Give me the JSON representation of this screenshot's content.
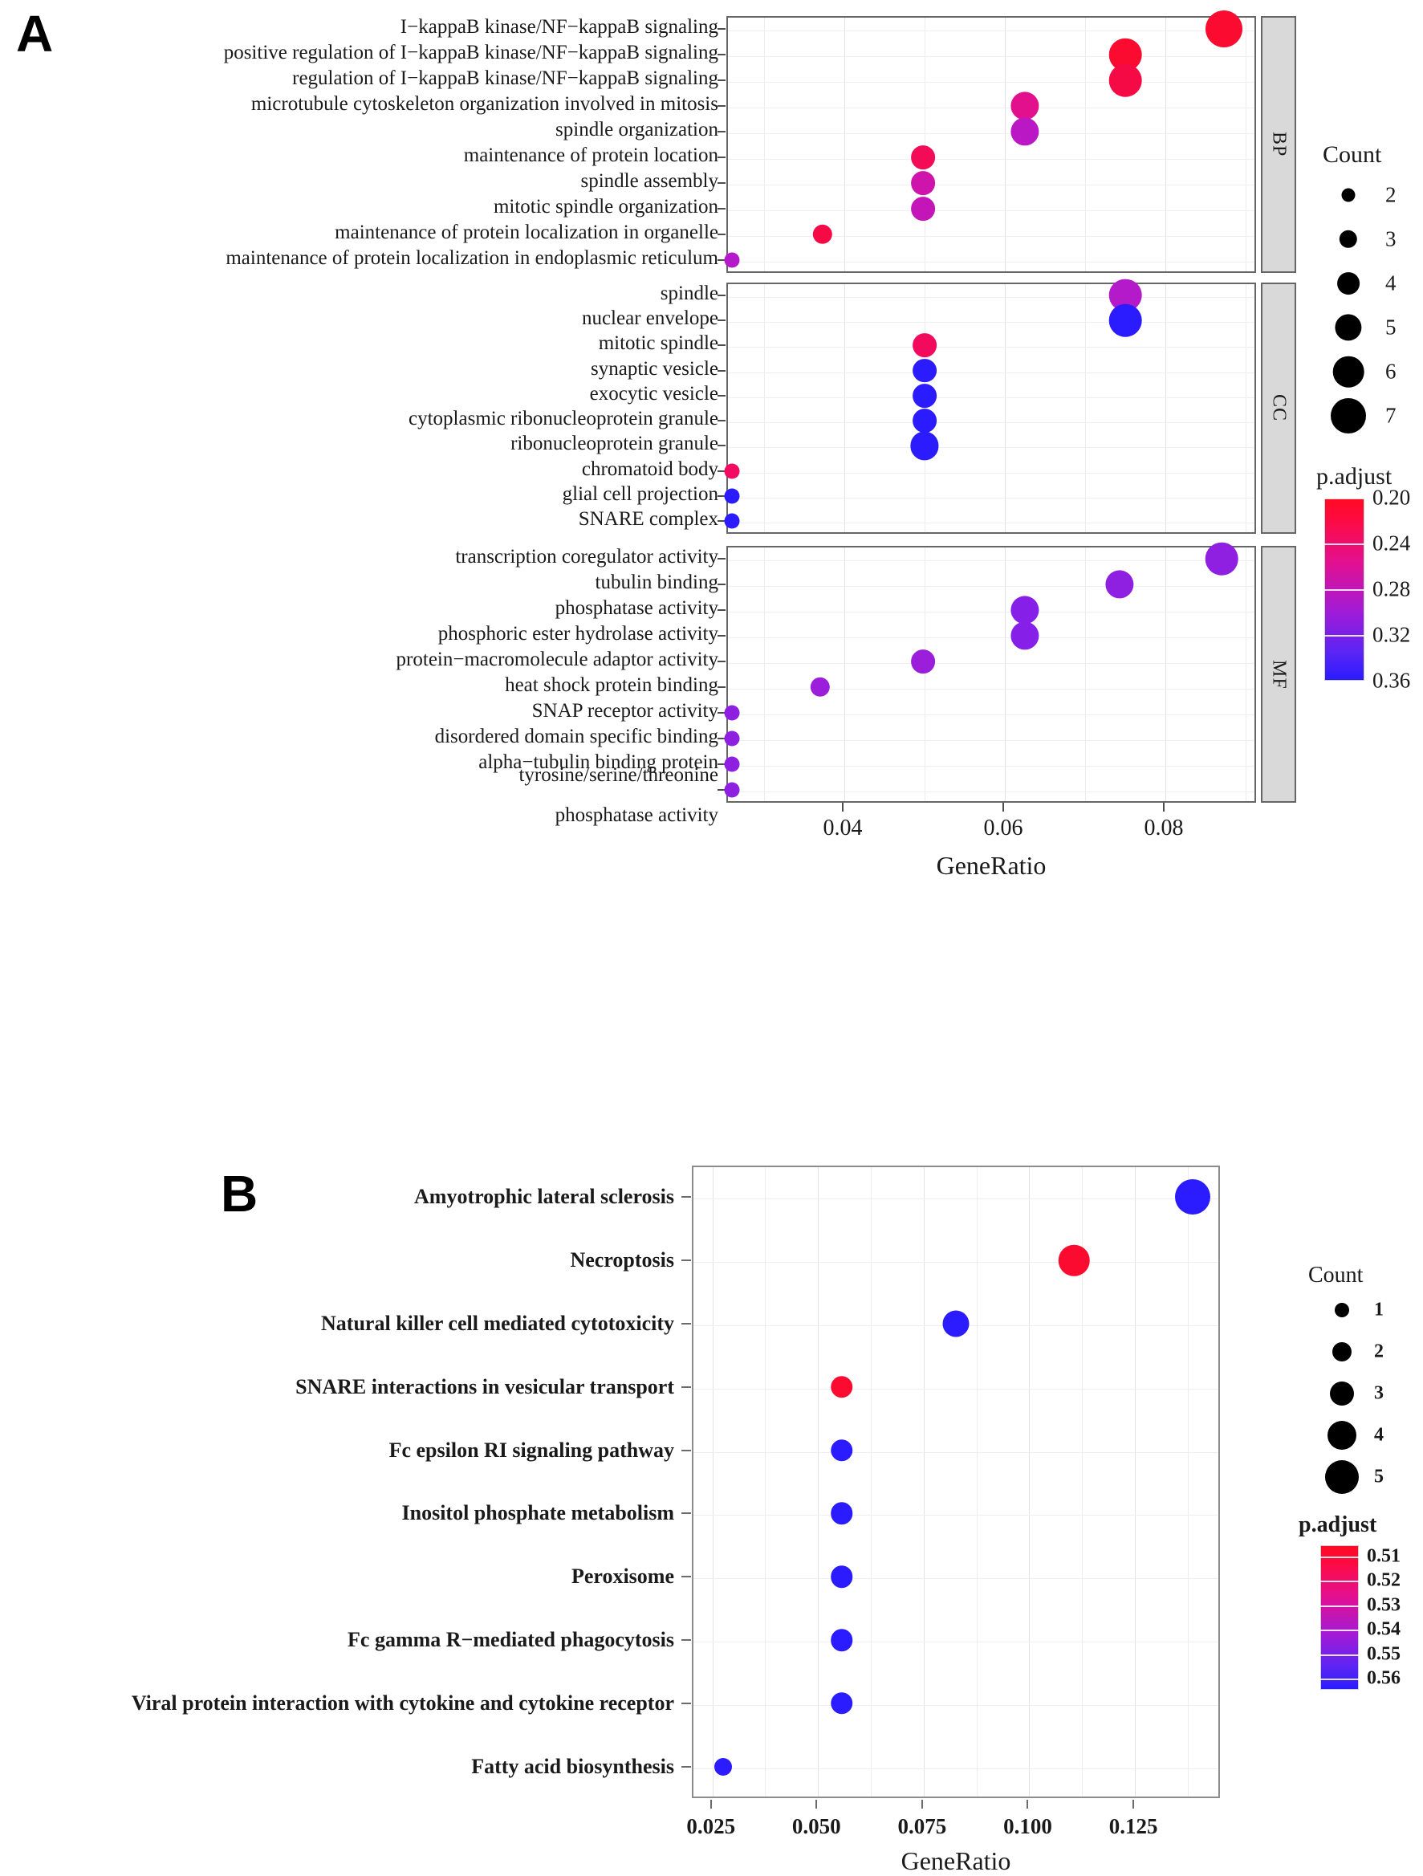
{
  "panels": {
    "a": {
      "letter": "A"
    },
    "b": {
      "letter": "B"
    }
  },
  "chart_data": [
    {
      "panel": "A",
      "type": "scatter",
      "title": "",
      "xlabel": "GeneRatio",
      "ylabel": "",
      "xlim": [
        0.0255,
        0.0915
      ],
      "xticks": [
        0.04,
        0.06,
        0.08
      ],
      "xticklabels": [
        "0.04",
        "0.06",
        "0.08"
      ],
      "grid": true,
      "facets": [
        {
          "name": "BP",
          "strip_label": "BP",
          "points": [
            {
              "term": "I−kappaB kinase/NF−kappaB signaling",
              "gene_ratio": 0.0875,
              "count": 7,
              "p_adjust": 0.205,
              "color": "#fb0b2f"
            },
            {
              "term": "positive regulation of I−kappaB kinase/NF−kappaB signaling",
              "gene_ratio": 0.0752,
              "count": 6,
              "p_adjust": 0.205,
              "color": "#fb0b2f"
            },
            {
              "term": "regulation of I−kappaB kinase/NF−kappaB signaling",
              "gene_ratio": 0.0752,
              "count": 6,
              "p_adjust": 0.215,
              "color": "#f50a45"
            },
            {
              "term": "microtubule cytoskeleton organization involved in mitosis",
              "gene_ratio": 0.0627,
              "count": 5,
              "p_adjust": 0.255,
              "color": "#e2108c"
            },
            {
              "term": "spindle organization",
              "gene_ratio": 0.0627,
              "count": 5,
              "p_adjust": 0.295,
              "color": "#b918c4"
            },
            {
              "term": "maintenance of protein location",
              "gene_ratio": 0.05,
              "count": 4,
              "p_adjust": 0.225,
              "color": "#f30b57"
            },
            {
              "term": "spindle assembly",
              "gene_ratio": 0.05,
              "count": 4,
              "p_adjust": 0.275,
              "color": "#cf14ac"
            },
            {
              "term": "mitotic spindle organization",
              "gene_ratio": 0.05,
              "count": 4,
              "p_adjust": 0.285,
              "color": "#c416b8"
            },
            {
              "term": "maintenance of protein localization in organelle",
              "gene_ratio": 0.0375,
              "count": 3,
              "p_adjust": 0.215,
              "color": "#f60a45"
            },
            {
              "term": "maintenance of protein localization in endoplasmic reticulum",
              "gene_ratio": 0.0262,
              "count": 2,
              "p_adjust": 0.3,
              "color": "#b41ac9"
            }
          ]
        },
        {
          "name": "CC",
          "strip_label": "CC",
          "points": [
            {
              "term": "spindle",
              "gene_ratio": 0.0752,
              "count": 6,
              "p_adjust": 0.3,
              "color": "#b41ac9"
            },
            {
              "term": "nuclear envelope",
              "gene_ratio": 0.0752,
              "count": 6,
              "p_adjust": 0.36,
              "color": "#2a1cff"
            },
            {
              "term": "mitotic spindle",
              "gene_ratio": 0.0502,
              "count": 4,
              "p_adjust": 0.23,
              "color": "#f20b5c"
            },
            {
              "term": "synaptic vesicle",
              "gene_ratio": 0.0502,
              "count": 4,
              "p_adjust": 0.36,
              "color": "#2a1cff"
            },
            {
              "term": "exocytic vesicle",
              "gene_ratio": 0.0502,
              "count": 4,
              "p_adjust": 0.36,
              "color": "#2a1cff"
            },
            {
              "term": "cytoplasmic ribonucleoprotein granule",
              "gene_ratio": 0.0502,
              "count": 4,
              "p_adjust": 0.36,
              "color": "#2a1cff"
            },
            {
              "term": "ribonucleoprotein granule",
              "gene_ratio": 0.0502,
              "count": 5,
              "p_adjust": 0.36,
              "color": "#2a1cff"
            },
            {
              "term": "chromatoid body",
              "gene_ratio": 0.0262,
              "count": 2,
              "p_adjust": 0.235,
              "color": "#f20b63"
            },
            {
              "term": "glial cell projection",
              "gene_ratio": 0.0262,
              "count": 2,
              "p_adjust": 0.36,
              "color": "#2a1cff"
            },
            {
              "term": "SNARE complex",
              "gene_ratio": 0.0262,
              "count": 2,
              "p_adjust": 0.36,
              "color": "#2a1cff"
            }
          ]
        },
        {
          "name": "MF",
          "strip_label": "MF",
          "points": [
            {
              "term": "transcription coregulator activity",
              "gene_ratio": 0.0872,
              "count": 6,
              "p_adjust": 0.315,
              "color": "#8f20e2"
            },
            {
              "term": "tubulin binding",
              "gene_ratio": 0.0745,
              "count": 5,
              "p_adjust": 0.315,
              "color": "#8f20e2"
            },
            {
              "term": "phosphatase activity",
              "gene_ratio": 0.0627,
              "count": 5,
              "p_adjust": 0.32,
              "color": "#8620e8"
            },
            {
              "term": "phosphoric ester hydrolase activity",
              "gene_ratio": 0.0627,
              "count": 5,
              "p_adjust": 0.32,
              "color": "#8620e8"
            },
            {
              "term": "protein−macromolecule adaptor activity",
              "gene_ratio": 0.05,
              "count": 4,
              "p_adjust": 0.31,
              "color": "#9a1eda"
            },
            {
              "term": "heat shock protein binding",
              "gene_ratio": 0.0372,
              "count": 3,
              "p_adjust": 0.31,
              "color": "#9a1eda"
            },
            {
              "term": "SNAP receptor activity",
              "gene_ratio": 0.0262,
              "count": 2,
              "p_adjust": 0.315,
              "color": "#8f20e2"
            },
            {
              "term": "disordered domain specific binding",
              "gene_ratio": 0.0262,
              "count": 2,
              "p_adjust": 0.315,
              "color": "#8f20e2"
            },
            {
              "term": "alpha−tubulin binding protein",
              "gene_ratio": 0.0262,
              "count": 2,
              "p_adjust": 0.315,
              "color": "#8f20e2"
            },
            {
              "term": "tyrosine/serine/threonine phosphatase activity",
              "gene_ratio": 0.0262,
              "count": 2,
              "p_adjust": 0.315,
              "color": "#8f20e2"
            }
          ]
        }
      ],
      "size_legend": {
        "title": "Count",
        "values": [
          "2",
          "3",
          "4",
          "5",
          "6",
          "7"
        ]
      },
      "color_legend": {
        "title": "p.adjust",
        "values": [
          "0.20",
          "0.24",
          "0.28",
          "0.32",
          "0.36"
        ],
        "high_color": "#ff0a23",
        "low_color": "#2a1cff"
      }
    },
    {
      "panel": "B",
      "type": "scatter",
      "title": "",
      "xlabel": "GeneRatio",
      "ylabel": "",
      "xlim": [
        0.0205,
        0.1455
      ],
      "xticks": [
        0.025,
        0.05,
        0.075,
        0.1,
        0.125
      ],
      "xticklabels": [
        "0.025",
        "0.050",
        "0.075",
        "0.100",
        "0.125"
      ],
      "grid": true,
      "points": [
        {
          "term": "Amyotrophic lateral sclerosis",
          "gene_ratio": 0.139,
          "count": 5,
          "p_adjust": 0.56,
          "color": "#2a1cff"
        },
        {
          "term": "Necroptosis",
          "gene_ratio": 0.111,
          "count": 4,
          "p_adjust": 0.51,
          "color": "#fb0b2f"
        },
        {
          "term": "Natural killer cell mediated cytotoxicity",
          "gene_ratio": 0.083,
          "count": 3,
          "p_adjust": 0.56,
          "color": "#2a1cff"
        },
        {
          "term": "SNARE interactions in vesicular transport",
          "gene_ratio": 0.056,
          "count": 2,
          "p_adjust": 0.51,
          "color": "#fb0b2f"
        },
        {
          "term": "Fc epsilon RI signaling pathway",
          "gene_ratio": 0.056,
          "count": 2,
          "p_adjust": 0.56,
          "color": "#2a1cff"
        },
        {
          "term": "Inositol phosphate metabolism",
          "gene_ratio": 0.056,
          "count": 2,
          "p_adjust": 0.56,
          "color": "#2a1cff"
        },
        {
          "term": "Peroxisome",
          "gene_ratio": 0.056,
          "count": 2,
          "p_adjust": 0.56,
          "color": "#2a1cff"
        },
        {
          "term": "Fc gamma R−mediated phagocytosis",
          "gene_ratio": 0.056,
          "count": 2,
          "p_adjust": 0.56,
          "color": "#2a1cff"
        },
        {
          "term": "Viral protein interaction with cytokine and cytokine receptor",
          "gene_ratio": 0.056,
          "count": 2,
          "p_adjust": 0.56,
          "color": "#2a1cff"
        },
        {
          "term": "Fatty acid biosynthesis",
          "gene_ratio": 0.028,
          "count": 1,
          "p_adjust": 0.56,
          "color": "#2a1cff"
        }
      ],
      "size_legend": {
        "title": "Count",
        "values": [
          "1",
          "2",
          "3",
          "4",
          "5"
        ]
      },
      "color_legend": {
        "title": "p.adjust",
        "values": [
          "0.51",
          "0.52",
          "0.53",
          "0.54",
          "0.55",
          "0.56"
        ],
        "high_color": "#ff0a23",
        "low_color": "#2a1cff"
      }
    }
  ],
  "panel_a_labels": [
    "I−kappaB kinase/NF−kappaB signaling",
    "positive regulation of I−kappaB kinase/NF−kappaB signaling",
    "regulation of I−kappaB kinase/NF−kappaB signaling",
    "microtubule cytoskeleton organization involved in mitosis",
    "spindle organization",
    "maintenance of protein location",
    "spindle assembly",
    "mitotic spindle organization",
    "maintenance of protein localization in organelle",
    "maintenance of protein localization in endoplasmic reticulum",
    "spindle",
    "nuclear envelope",
    "mitotic spindle",
    "synaptic vesicle",
    "exocytic vesicle",
    "cytoplasmic ribonucleoprotein granule",
    "ribonucleoprotein granule",
    "chromatoid body",
    "glial cell projection",
    "SNARE complex",
    "transcription coregulator activity",
    "tubulin binding",
    "phosphatase activity",
    "phosphoric ester hydrolase activity",
    "protein−macromolecule adaptor activity",
    "heat shock protein binding",
    "SNAP receptor activity",
    "disordered domain specific binding",
    "alpha−tubulin binding protein",
    "tyrosine/serine/threonine",
    "phosphatase activity"
  ]
}
